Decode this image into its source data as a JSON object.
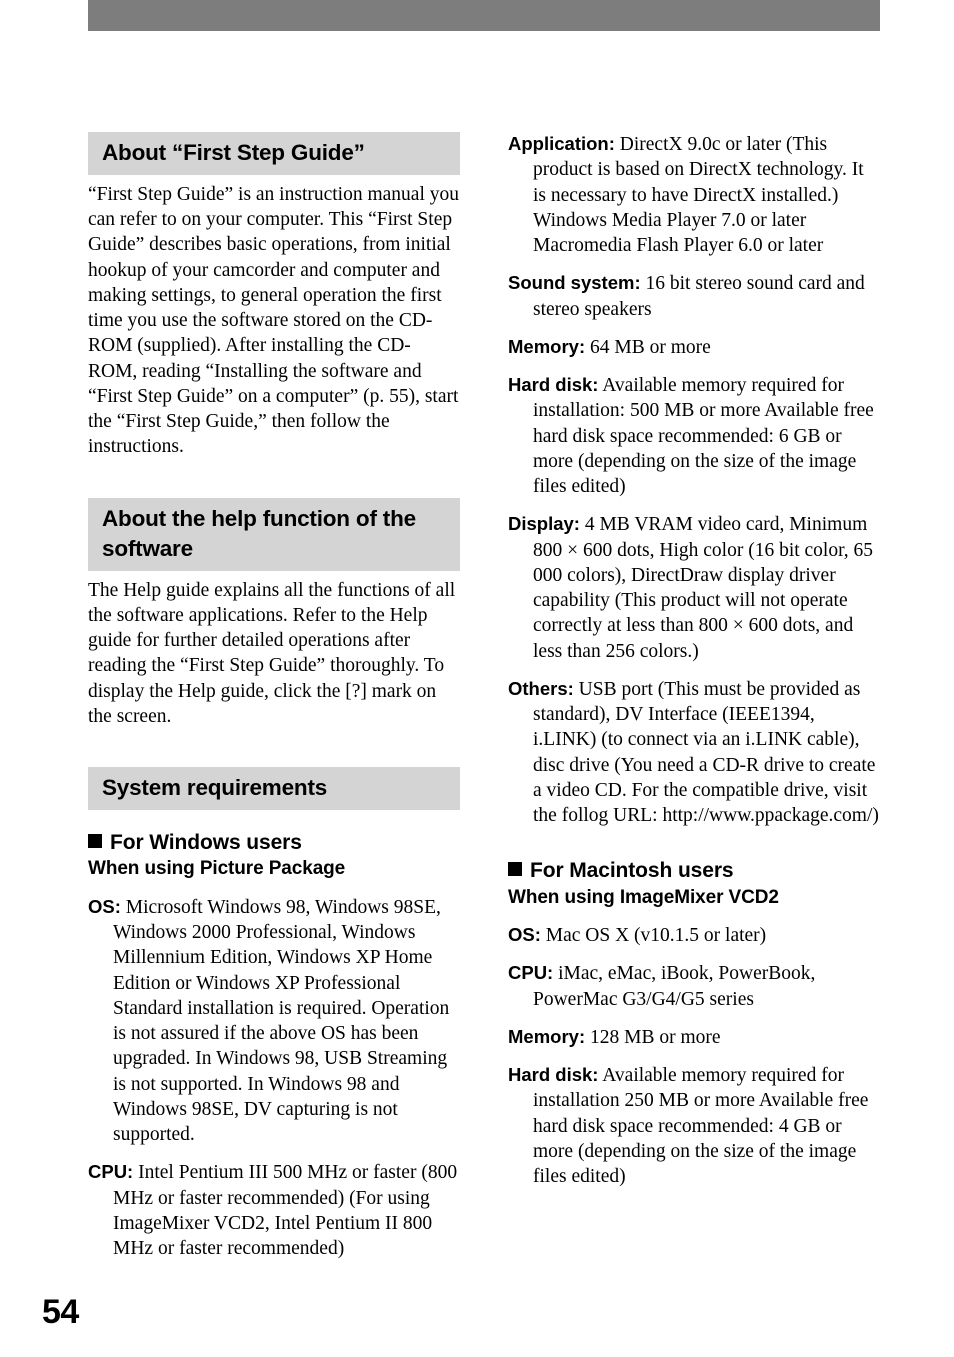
{
  "page": {
    "folio": "54"
  },
  "left_column": {
    "section1": {
      "heading": "About “First Step Guide”",
      "body": "“First Step Guide” is an instruction manual you can refer to on your computer.\nThis “First Step Guide” describes basic operations, from initial hookup of your camcorder and computer and making settings, to general operation the first time you use the software stored on the CD-ROM (supplied). After installing the CD-ROM, reading “Installing the software and “First Step Guide” on a computer” (p. 55), start the “First Step Guide,” then follow the instructions."
    },
    "section2": {
      "heading": "About the help function of the software",
      "body": "The Help guide explains all the functions of all the software applications. Refer to the Help guide for further detailed operations after reading the “First Step Guide” thoroughly. To display the Help guide, click the [?] mark on the screen."
    },
    "section3": {
      "heading": "System requirements",
      "windows_heading": "For Windows users",
      "windows_subheading": "When using Picture Package",
      "specs": [
        {
          "label": "OS:",
          "value": "Microsoft Windows 98, Windows 98SE, Windows 2000 Professional, Windows Millennium Edition, Windows XP Home Edition or Windows XP Professional Standard installation is required. Operation is not assured if the above OS has been upgraded. In Windows 98, USB Streaming is not supported. In Windows 98 and Windows 98SE, DV capturing is not supported."
        },
        {
          "label": "CPU:",
          "value": "Intel Pentium III 500 MHz or faster (800 MHz or faster recommended) (For using ImageMixer VCD2, Intel Pentium II 800 MHz or faster recommended)"
        }
      ]
    }
  },
  "right_column": {
    "windows_specs": [
      {
        "label": "Application:",
        "value": "DirectX 9.0c or later (This product is based on DirectX technology. It is necessary to have DirectX installed.) Windows Media Player 7.0 or later Macromedia Flash Player 6.0 or later"
      },
      {
        "label": "Sound system:",
        "value": "16 bit stereo sound card and stereo speakers"
      },
      {
        "label": "Memory:",
        "value": "64 MB or more"
      },
      {
        "label": "Hard disk:",
        "value": "Available memory required for installation: 500 MB or more Available free hard disk space recommended: 6 GB or more (depending on the size of the image files edited)"
      },
      {
        "label": "Display:",
        "value": "4 MB VRAM video card, Minimum 800 × 600 dots, High color (16 bit color, 65 000 colors), DirectDraw display driver capability (This product will not operate correctly at less than 800 × 600 dots, and less than 256 colors.)"
      },
      {
        "label": "Others:",
        "value": "USB port (This must be provided as standard), DV Interface (IEEE1394, i.LINK) (to connect via an i.LINK cable), disc drive (You need a CD-R drive to create a video CD. For the compatible drive, visit the follog URL: http://www.ppackage.com/)"
      }
    ],
    "macintosh_heading": "For Macintosh users",
    "macintosh_subheading": "When using ImageMixer VCD2",
    "macintosh_specs": [
      {
        "label": "OS:",
        "value": "Mac OS X (v10.1.5 or later)"
      },
      {
        "label": "CPU:",
        "value": "iMac, eMac, iBook, PowerBook, PowerMac G3/G4/G5 series"
      },
      {
        "label": "Memory:",
        "value": "128 MB or more"
      },
      {
        "label": "Hard disk:",
        "value": "Available memory required for installation 250 MB or more Available free hard disk space recommended: 4 GB or more (depending on the size of the image files edited)"
      }
    ]
  }
}
